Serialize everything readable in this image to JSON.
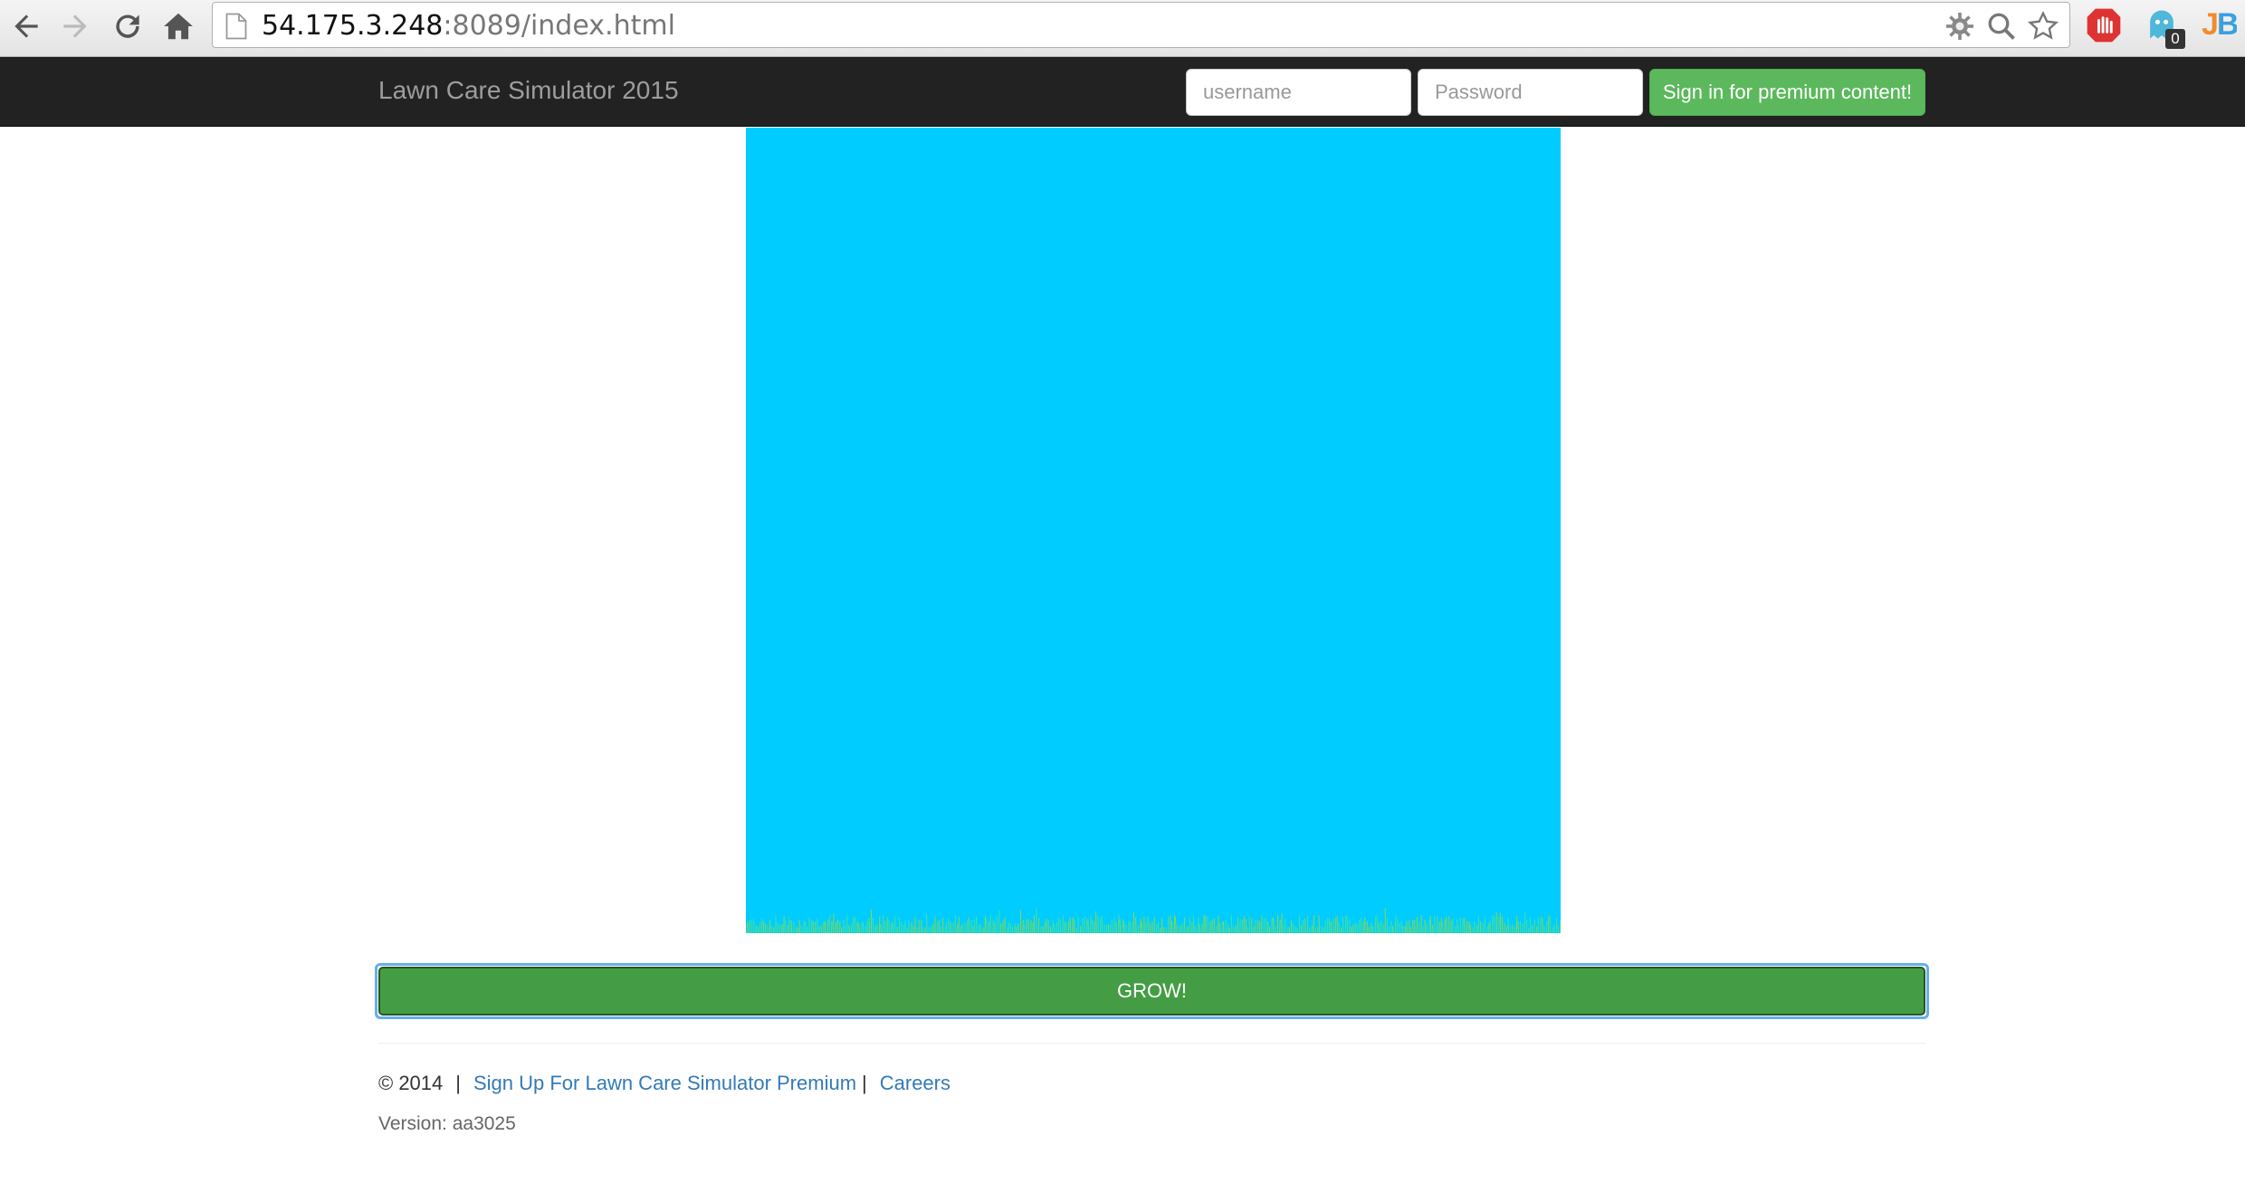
{
  "browser": {
    "url_host": "54.175.3.248",
    "url_rest": ":8089/index.html",
    "extension_badge": "0",
    "jb_label": "JB"
  },
  "navbar": {
    "brand": "Lawn Care Simulator 2015",
    "username_placeholder": "username",
    "password_placeholder": "Password",
    "signin_label": "Sign in for premium content!"
  },
  "main": {
    "grow_label": "GROW!"
  },
  "footer": {
    "copyright": "© 2014",
    "separator": "|",
    "premium_link": "Sign Up For Lawn Care Simulator Premium",
    "careers_link": "Careers",
    "version_text": "Version: aa3025"
  },
  "colors": {
    "navbar_bg": "#222222",
    "sky": "#00ccff",
    "grass": "#7ed957",
    "success": "#5cb85c",
    "grow_button": "#449d44",
    "link": "#337ab7"
  }
}
